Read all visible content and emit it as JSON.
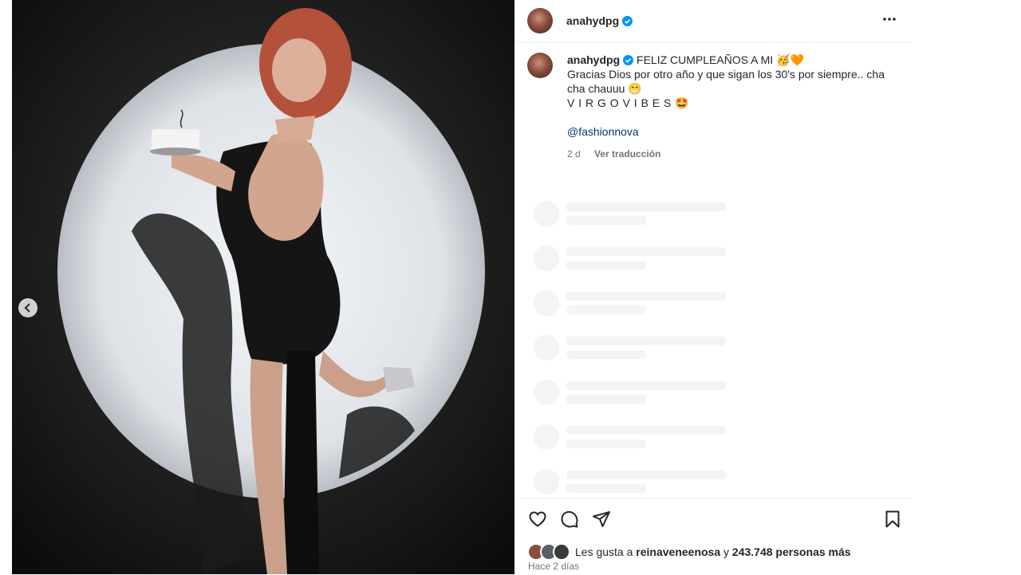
{
  "post": {
    "username": "anahydpg",
    "caption": {
      "line1": "FELIZ CUMPLEAÑOS A MI 🥳🧡",
      "line2": "Gracias Dios por otro año y que sigan los 30's por siempre.. cha cha chauuu 😁",
      "line3": "V I R G O V I B E S 🤩",
      "mention": "@fashionnova",
      "age": "2 d",
      "translate_label": "Ver traducción"
    },
    "likes": {
      "prefix": "Les gusta a",
      "user": "reinaveneenosa",
      "joiner": "y",
      "count_text": "243.748 personas más"
    },
    "timestamp": "Hace 2 días"
  },
  "icons": {
    "verified": "verified-badge-icon",
    "more": "more-options-icon",
    "like": "heart-icon",
    "comment": "comment-icon",
    "share": "share-icon",
    "save": "bookmark-icon",
    "prev": "chevron-left-icon"
  },
  "colors": {
    "verified": "#0095f6",
    "mention": "#00376b",
    "text": "#262626",
    "secondary": "#737373"
  },
  "skeleton_rows": 7
}
